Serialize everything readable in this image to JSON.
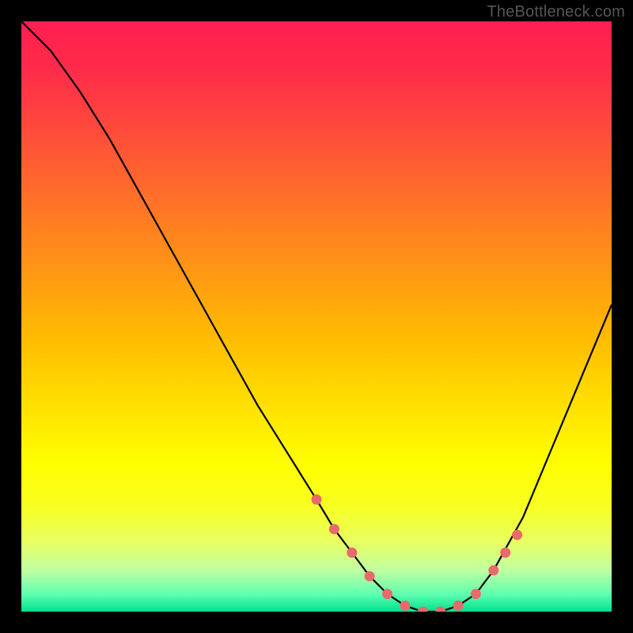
{
  "watermark": "TheBottleneck.com",
  "chart_data": {
    "type": "line",
    "title": "",
    "xlabel": "",
    "ylabel": "",
    "xlim": [
      0,
      100
    ],
    "ylim": [
      0,
      100
    ],
    "series": [
      {
        "name": "bottleneck-curve",
        "x": [
          0,
          5,
          10,
          15,
          20,
          25,
          30,
          35,
          40,
          45,
          50,
          53,
          56,
          59,
          62,
          65,
          68,
          71,
          74,
          77,
          80,
          85,
          90,
          95,
          100
        ],
        "y": [
          100,
          95,
          88,
          80,
          71,
          62,
          53,
          44,
          35,
          27,
          19,
          14,
          10,
          6,
          3,
          1,
          0,
          0,
          1,
          3,
          7,
          16,
          28,
          40,
          52
        ]
      }
    ],
    "markers": {
      "name": "highlight-points",
      "x": [
        50,
        53,
        56,
        59,
        62,
        65,
        68,
        71,
        74,
        77,
        80,
        82,
        84
      ],
      "y": [
        19,
        14,
        10,
        6,
        3,
        1,
        0,
        0,
        1,
        3,
        7,
        10,
        13
      ]
    },
    "colors": {
      "curve": "#000000",
      "marker": "#e86a6a",
      "gradient_top": "#ff1e50",
      "gradient_bottom": "#00e090"
    }
  }
}
